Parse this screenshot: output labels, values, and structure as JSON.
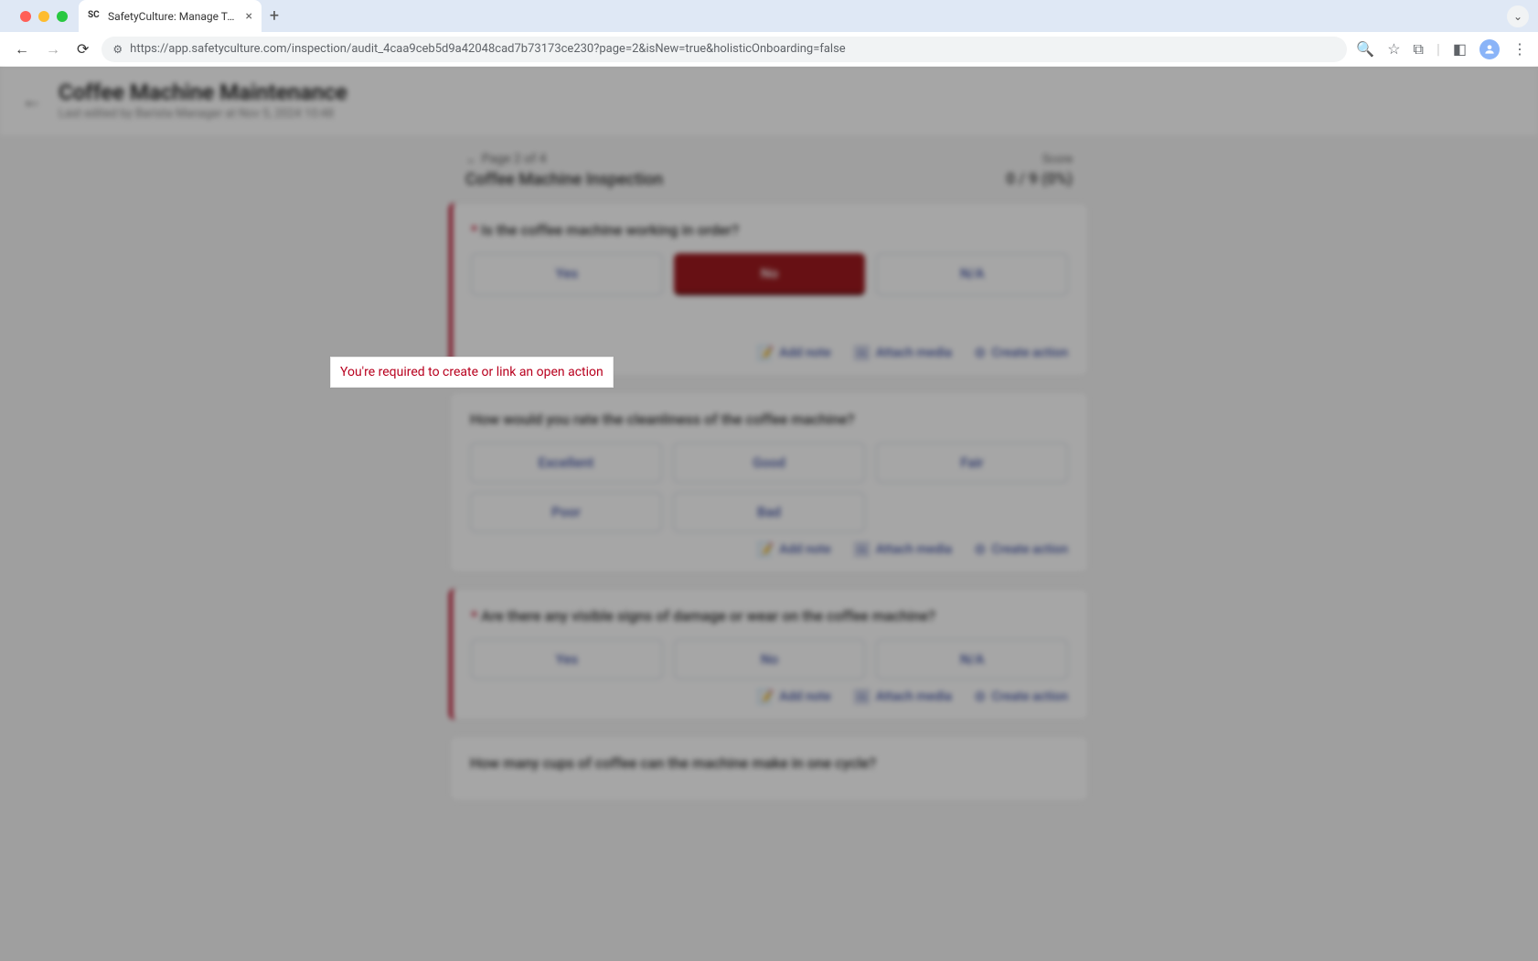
{
  "browser": {
    "tab_title": "SafetyCulture: Manage Teams and...",
    "url": "https://app.safetyculture.com/inspection/audit_4caa9ceb5d9a42048cad7b73173ce230?page=2&isNew=true&holisticOnboarding=false"
  },
  "header": {
    "title": "Coffee Machine Maintenance",
    "subtitle": "Last edited by Barista Manager at Nov 5, 2024 10:48"
  },
  "page_info": {
    "label": "Page 2 of 4",
    "score_label": "Score"
  },
  "section": {
    "title": "Coffee Machine Inspection",
    "score": "0 / 9 (0%)"
  },
  "validation": {
    "message": "You're required to create or link an open action"
  },
  "actions": {
    "add_note": "Add note",
    "attach_media": "Attach media",
    "create_action": "Create action"
  },
  "questions": [
    {
      "required": true,
      "text": "Is the coffee machine working in order?",
      "options": [
        "Yes",
        "No",
        "N/A"
      ],
      "selected": "No",
      "show_validation": true
    },
    {
      "required": false,
      "text": "How would you rate the cleanliness of the coffee machine?",
      "options_row1": [
        "Excellent",
        "Good",
        "Fair"
      ],
      "options_row2": [
        "Poor",
        "Bad"
      ]
    },
    {
      "required": true,
      "text": "Are there any visible signs of damage or wear on the coffee machine?",
      "options": [
        "Yes",
        "No",
        "N/A"
      ]
    },
    {
      "required": false,
      "text": "How many cups of coffee can the machine make in one cycle?"
    }
  ]
}
